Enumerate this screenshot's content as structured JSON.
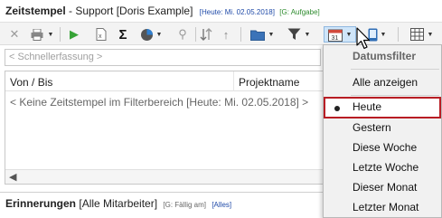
{
  "title": {
    "bold": "Zeitstempel",
    "normal": " - Support [Doris Example]",
    "today": "[Heute: Mi. 02.05.2018]",
    "group": "[G: Aufgabe]"
  },
  "toolbar": {
    "icons": [
      "close-icon",
      "print-icon",
      "play-icon",
      "document-icon",
      "sigma-icon",
      "pie-chart-icon",
      "link-icon",
      "sort-icon",
      "folder-icon",
      "filter-icon",
      "calendar-filter-icon",
      "device-icon",
      "table-icon"
    ]
  },
  "quick_entry": {
    "placeholder": "< Schnellerfassung >"
  },
  "grid": {
    "columns": [
      "Von / Bis",
      "Projektname"
    ],
    "empty_text": "< Keine Zeitstempel im Filterbereich [Heute: Mi. 02.05.2018] >"
  },
  "bottom_bar": {
    "bold": "Erinnerungen",
    "normal": "[Alle Mitarbeiter]",
    "due": "[G: Fällig am]",
    "all": "[Alles]"
  },
  "date_filter_menu": {
    "header": "Datumsfilter",
    "show_all": "Alle anzeigen",
    "items": [
      "Heute",
      "Gestern",
      "Diese Woche",
      "Letzte Woche",
      "Dieser Monat",
      "Letzter Monat"
    ],
    "selected": "Heute"
  },
  "colors": {
    "highlight_border": "#b81d24",
    "title_blue": "#1f4aa8",
    "title_green": "#2e8b2e"
  }
}
